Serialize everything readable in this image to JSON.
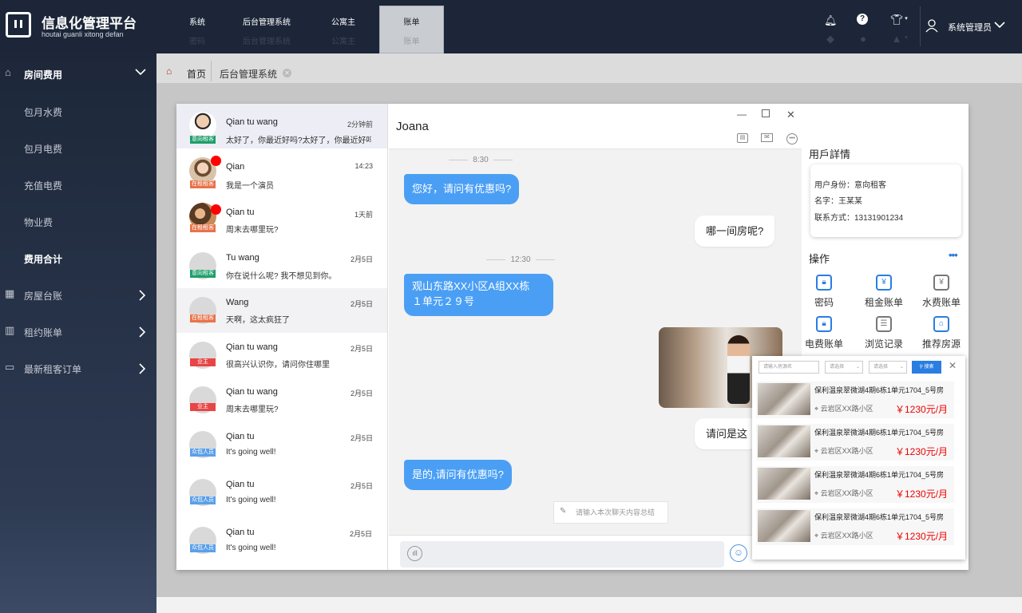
{
  "app": {
    "title": "信息化管理平台",
    "subtitle": "houtai guanli xitong defan"
  },
  "topnav": [
    {
      "label": "系统",
      "sub": "密码"
    },
    {
      "label": "后台管理系统",
      "sub": "后台管理系统"
    },
    {
      "label": "公寓主",
      "sub": "公寓主"
    },
    {
      "label": "账单",
      "sub": "账单"
    }
  ],
  "user": {
    "name": "系统管理员"
  },
  "sidebar": {
    "items": [
      {
        "label": "房间费用"
      },
      {
        "label": "包月水费"
      },
      {
        "label": "包月电费"
      },
      {
        "label": "充值电费"
      },
      {
        "label": "物业费"
      },
      {
        "label": "费用合计"
      },
      {
        "label": "房屋台账"
      },
      {
        "label": "租约账单"
      },
      {
        "label": "最新租客订单"
      }
    ]
  },
  "tabs": {
    "home": "首页",
    "current": "后台管理系统"
  },
  "contacts": [
    {
      "name": "Qian tu wang",
      "time": "2分钟前",
      "msg": "太好了，你最近好吗?太好了，你最近好吗?",
      "badge": "意向租客"
    },
    {
      "name": "Qian",
      "time": "14:23",
      "msg": "我是一个演员",
      "badge": "在租租客"
    },
    {
      "name": "Qian tu",
      "time": "1天前",
      "msg": "周末去哪里玩?",
      "badge": "在租租客"
    },
    {
      "name": "Tu wang",
      "time": "2月5日",
      "msg": "你在说什么呢? 我不想见到你。",
      "badge": "意向租客"
    },
    {
      "name": "Wang",
      "time": "2月5日",
      "msg": "天啊，这太疯狂了",
      "badge": "在租租客"
    },
    {
      "name": "Qian tu wang",
      "time": "2月5日",
      "msg": "很高兴认识你，请问你住哪里",
      "badge": "业主"
    },
    {
      "name": "Qian tu wang",
      "time": "2月5日",
      "msg": "周末去哪里玩?",
      "badge": "业主"
    },
    {
      "name": "Qian tu",
      "time": "2月5日",
      "msg": "It's going well!",
      "badge": "众包人员"
    },
    {
      "name": "Qian tu",
      "time": "2月5日",
      "msg": "It's going well!",
      "badge": "众包人员"
    },
    {
      "name": "Qian tu",
      "time": "2月5日",
      "msg": "It's going well!",
      "badge": "众包人员"
    }
  ],
  "badge_colors": {
    "意向租客": "#1e9e6a",
    "在租租客": "#e8734a",
    "业主": "#e84545",
    "众包人员": "#5aa0e8"
  },
  "chat": {
    "title": "Joana",
    "times": [
      "8:30",
      "12:30"
    ],
    "messages": [
      {
        "side": "left",
        "text": "您好，请问有优惠吗?"
      },
      {
        "side": "right",
        "text": "哪一间房呢?"
      },
      {
        "side": "left",
        "text": "观山东路XX小区A组XX栋"
      },
      {
        "side": "left",
        "text": "１单元２９号"
      },
      {
        "side": "right",
        "text": "请问是这"
      },
      {
        "side": "left",
        "text": "是的,请问有优惠吗?"
      }
    ],
    "summary_placeholder": "请输入本次聊天内容总结"
  },
  "user_detail": {
    "title": "用戶詳情",
    "identity": "用户身份：意向租客",
    "name": "名字：王某某",
    "contact": "联系方式：13131901234"
  },
  "ops": {
    "title": "操作",
    "more": "•••",
    "items": [
      "密码",
      "租金账单",
      "水费账单",
      "电费账单",
      "浏览记录",
      "推荐房源"
    ]
  },
  "popup": {
    "search_placeholder": "请输入房源名",
    "select1": "请选择",
    "select2": "请选择",
    "search_btn": "搜索",
    "props": [
      {
        "title": "保利温泉翠微湖4期6栋1单元1704_5号房",
        "loc": "云岩区XX路小区",
        "price": "￥1230元/月"
      },
      {
        "title": "保利温泉翠微湖4期6栋1单元1704_5号房",
        "loc": "云岩区XX路小区",
        "price": "￥1230元/月"
      },
      {
        "title": "保利温泉翠微湖4期6栋1单元1704_5号房",
        "loc": "云岩区XX路小区",
        "price": "￥1230元/月"
      },
      {
        "title": "保利温泉翠微湖4期6栋1单元1704_5号房",
        "loc": "云岩区XX路小区",
        "price": "￥1230元/月"
      }
    ]
  }
}
